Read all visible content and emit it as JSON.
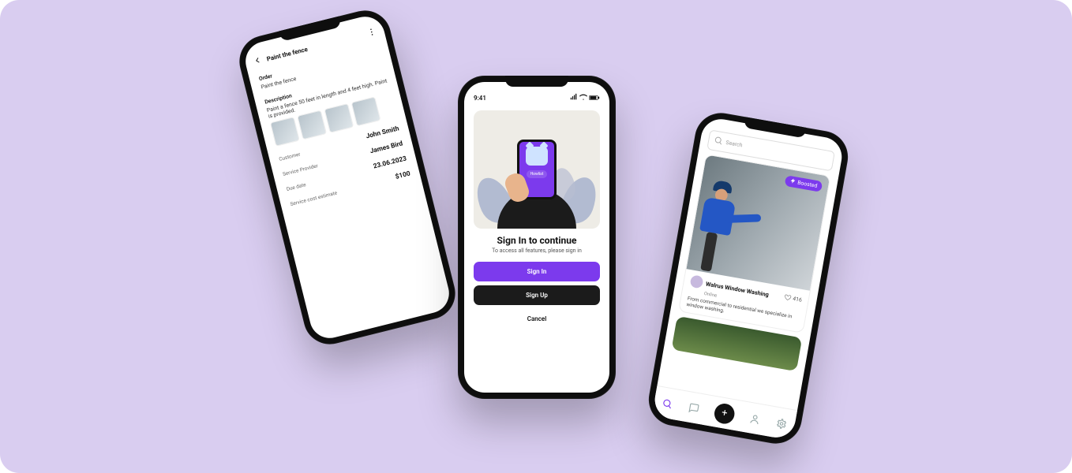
{
  "phone1": {
    "header": {
      "title": "Paint the fence"
    },
    "order": {
      "label": "Order",
      "value": "Paint the fence"
    },
    "description": {
      "label": "Description",
      "text": "Paint a fence 50 feet in length and 4 feet high. Paint is provided."
    },
    "customer": {
      "label": "Customer",
      "value": "John Smith"
    },
    "provider": {
      "label": "Service Provider",
      "value": "James Bird"
    },
    "due": {
      "label": "Due date",
      "value": "23.06.2023"
    },
    "cost": {
      "label": "Service cost estimate",
      "value": "$100"
    }
  },
  "phone2": {
    "status": {
      "time": "9:41"
    },
    "app_name": "Howlist",
    "title": "Sign In to continue",
    "subtitle": "To access all features, please sign in",
    "buttons": {
      "signin": "Sign In",
      "signup": "Sign Up",
      "cancel": "Cancel"
    }
  },
  "phone3": {
    "search": {
      "placeholder": "Search"
    },
    "badge": "Boosted",
    "listing": {
      "name": "Walrus Window Washing",
      "status": "Online",
      "likes": "416",
      "description": "From commercial to residential we specialize in window washing."
    }
  }
}
